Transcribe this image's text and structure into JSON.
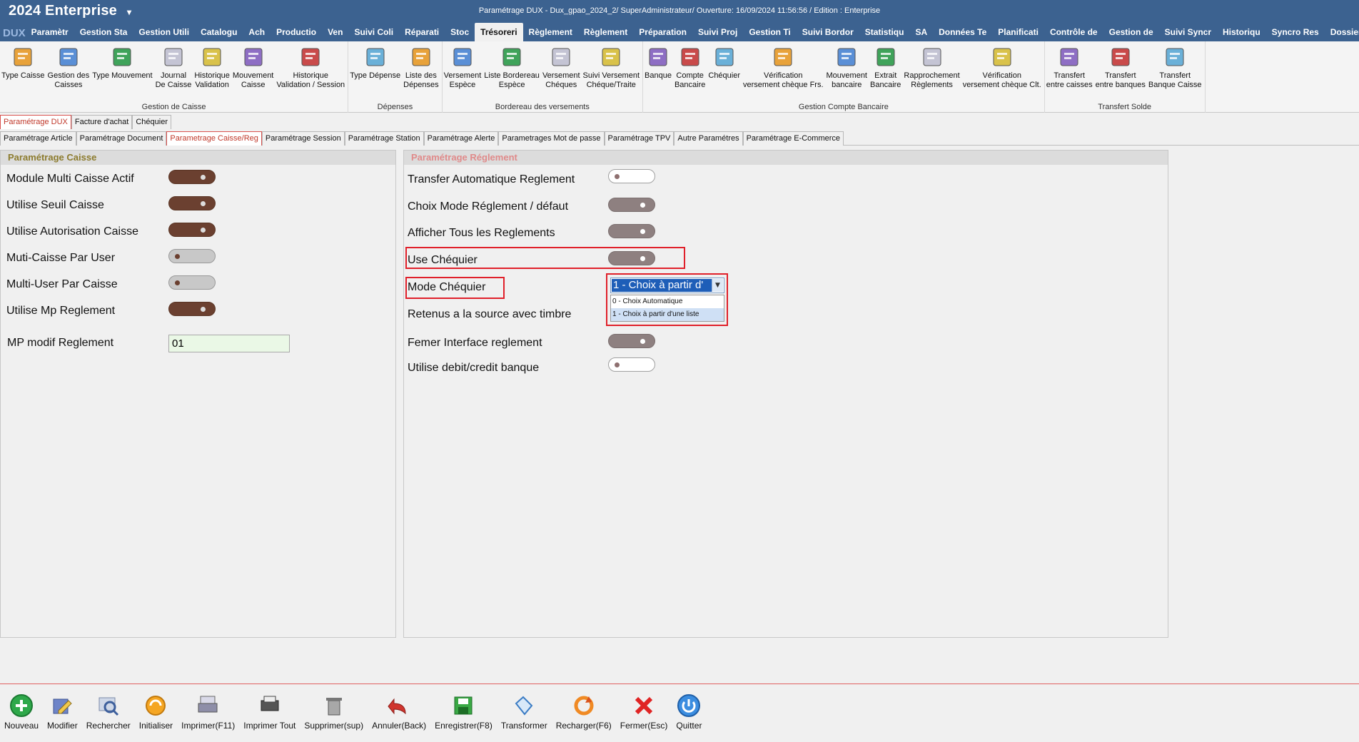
{
  "app": {
    "name": "2024  Enterprise",
    "logo": "DUX",
    "window_title": "Paramétrage DUX - Dux_gpao_2024_2/ SuperAdministrateur/ Ouverture: 16/09/2024 11:56:56 / Edition : Enterprise"
  },
  "menu": {
    "items": [
      "Paramètr",
      "Gestion Sta",
      "Gestion Utili",
      "Catalogu",
      "Ach",
      "Productio",
      "Ven",
      "Suivi Coli",
      "Réparati",
      "Stoc",
      "Trésoreri",
      "Règlement",
      "Règlement",
      "Préparation",
      "Suivi Proj",
      "Gestion Ti",
      "Suivi Bordor",
      "Statistiqu",
      "SA",
      "Données Te",
      "Planificati",
      "Contrôle de",
      "Gestion de",
      "Suivi Syncr",
      "Historiqu",
      "Syncro Res",
      "Dossier imp"
    ],
    "active_index": 10
  },
  "ribbon": {
    "groups": [
      {
        "label": "Gestion de Caisse",
        "buttons": [
          {
            "label": "Type Caisse",
            "icon": "cash-register-icon"
          },
          {
            "label": "Gestion des\nCaisses",
            "icon": "cash-drawer-icon"
          },
          {
            "label": "Type Mouvement",
            "icon": "document-gear-icon"
          },
          {
            "label": "Journal\nDe Caisse",
            "icon": "calendar-journal-icon"
          },
          {
            "label": "Historique\nValidation",
            "icon": "history-validation-icon"
          },
          {
            "label": "Mouvement\nCaisse",
            "icon": "up-down-arrows-icon"
          },
          {
            "label": "Historique\nValidation / Session",
            "icon": "history-session-icon"
          }
        ]
      },
      {
        "label": "Dépenses",
        "buttons": [
          {
            "label": "Type Dépense",
            "icon": "document-icon"
          },
          {
            "label": "Liste des\nDépenses",
            "icon": "coins-icon"
          }
        ]
      },
      {
        "label": "Bordereau des versements",
        "buttons": [
          {
            "label": "Versement\nEspèce",
            "icon": "cash-deposit-icon"
          },
          {
            "label": "Liste Bordereau\nEspèce",
            "icon": "folder-coins-icon"
          },
          {
            "label": "Versement\nChéques",
            "icon": "cheque-deposit-icon"
          },
          {
            "label": "Suivi Versement\nChéque/Traite",
            "icon": "cheque-tracking-icon"
          }
        ]
      },
      {
        "label": "Gestion Compte Bancaire",
        "buttons": [
          {
            "label": "Banque",
            "icon": "bank-icon"
          },
          {
            "label": "Compte\nBancaire",
            "icon": "bank-account-icon"
          },
          {
            "label": "Chéquier",
            "icon": "chequebook-icon"
          },
          {
            "label": "Vérification\nversement chèque Frs.",
            "icon": "cheque-verify-icon"
          },
          {
            "label": "Mouvement\nbancaire",
            "icon": "bank-movement-icon"
          },
          {
            "label": "Extrait\nBancaire",
            "icon": "bank-statement-icon"
          },
          {
            "label": "Rapprochement\nRèglements",
            "icon": "reconciliation-icon"
          },
          {
            "label": "Vérification\nversement chèque Clt.",
            "icon": "cheque-client-verify-icon"
          }
        ]
      },
      {
        "label": "Transfert Solde",
        "buttons": [
          {
            "label": "Transfert\nentre caisses",
            "icon": "transfer-cash-icon"
          },
          {
            "label": "Transfert\nentre banques",
            "icon": "transfer-bank-icon"
          },
          {
            "label": "Transfert\nBanque Caisse",
            "icon": "transfer-bank-cash-icon"
          }
        ]
      }
    ]
  },
  "tabs_level1": {
    "items": [
      "Paramétrage DUX",
      "Facture d'achat",
      "Chéquier"
    ],
    "active_index": 0
  },
  "tabs_level2": {
    "items": [
      "Paramétrage Article",
      "Paramétrage Document",
      "Parametrage Caisse/Reg",
      "Paramétrage Session",
      "Paramétrage Station",
      "Paramétrage Alerte",
      "Parametrages Mot de passe",
      "Paramétrage TPV",
      "Autre Paramétres",
      "Paramétrage E-Commerce"
    ],
    "active_index": 2
  },
  "caisse": {
    "title": "Paramétrage Caisse",
    "settings": [
      {
        "label": "Module Multi Caisse Actif",
        "state": "on"
      },
      {
        "label": "Utilise Seuil Caisse",
        "state": "on"
      },
      {
        "label": "Utilise Autorisation Caisse",
        "state": "on"
      },
      {
        "label": "Muti-Caisse Par User",
        "state": "off"
      },
      {
        "label": "Multi-User Par Caisse",
        "state": "off"
      },
      {
        "label": "Utilise Mp Reglement",
        "state": "on"
      }
    ],
    "mp_label": "MP modif Reglement",
    "mp_value": "01"
  },
  "reglement": {
    "title": "Paramétrage Réglement",
    "settings": [
      {
        "label": "Transfer Automatique Reglement",
        "state": "off"
      },
      {
        "label": "Choix Mode Réglement / défaut",
        "state": "on"
      },
      {
        "label": "Afficher Tous les Reglements",
        "state": "on"
      },
      {
        "label": "Use Chéquier",
        "state": "on"
      },
      {
        "label": "Mode Chéquier",
        "state": "combo"
      },
      {
        "label": "Retenus a la source avec timbre",
        "state": "none"
      },
      {
        "label": "Femer Interface reglement",
        "state": "on"
      },
      {
        "label": "Utilise debit/credit banque",
        "state": "off"
      }
    ],
    "mode_chequier": {
      "value": "1 - Choix à partir d'",
      "options": [
        "0 - Choix Automatique",
        "1 - Choix à partir d'une liste"
      ],
      "selected_index": 1
    }
  },
  "bottom_toolbar": [
    {
      "label": "Nouveau",
      "icon": "plus-icon"
    },
    {
      "label": "Modifier",
      "icon": "edit-icon"
    },
    {
      "label": "Rechercher",
      "icon": "search-icon"
    },
    {
      "label": "Initialiser",
      "icon": "reset-icon"
    },
    {
      "label": "Imprimer(F11)",
      "icon": "print-icon"
    },
    {
      "label": "Imprimer Tout",
      "icon": "print-all-icon"
    },
    {
      "label": "Supprimer(sup)",
      "icon": "trash-icon"
    },
    {
      "label": "Annuler(Back)",
      "icon": "undo-icon"
    },
    {
      "label": "Enregistrer(F8)",
      "icon": "save-icon"
    },
    {
      "label": "Transformer",
      "icon": "transform-icon"
    },
    {
      "label": "Recharger(F6)",
      "icon": "reload-icon"
    },
    {
      "label": "Fermer(Esc)",
      "icon": "close-icon"
    },
    {
      "label": "Quitter",
      "icon": "power-icon"
    }
  ],
  "colors": {
    "titlebar": "#3c6290",
    "toggle_on": "#6b4030",
    "highlight_box": "#e0202a",
    "active_tab": "#c0392b"
  }
}
